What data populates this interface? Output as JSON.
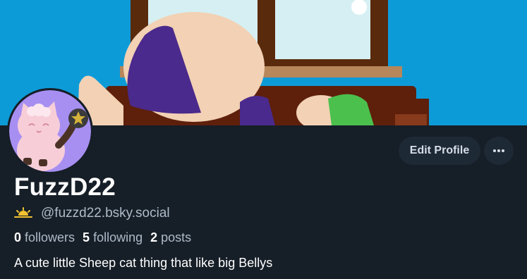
{
  "profile": {
    "display_name": "FuzzD22",
    "handle": "@fuzzd22.bsky.social",
    "handle_emoji_icon": "sunrise-icon",
    "bio": "A cute little Sheep cat thing that like big Bellys"
  },
  "stats": {
    "followers_count": "0",
    "followers_label": "followers",
    "following_count": "5",
    "following_label": "following",
    "posts_count": "2",
    "posts_label": "posts"
  },
  "actions": {
    "edit_profile_label": "Edit Profile",
    "more_icon": "ellipsis-icon"
  },
  "colors": {
    "background": "#161e27",
    "button_bg": "#1e2936",
    "banner_sky": "#0d9bd8",
    "muted_text": "#aebbc9"
  }
}
